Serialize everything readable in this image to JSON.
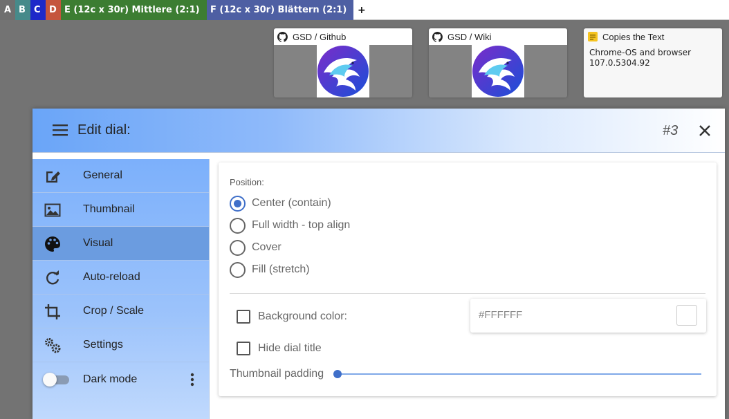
{
  "tabs": [
    {
      "label": "A",
      "color": "#6f6f6f"
    },
    {
      "label": "B",
      "color": "#468a8a"
    },
    {
      "label": "C",
      "color": "#1d29c9"
    },
    {
      "label": "D",
      "color": "#c5553d"
    },
    {
      "label": "E (12c x 30r) Mittlere (2:1)",
      "color": "#3c7d32"
    },
    {
      "label": "F (12c x 30r) Blättern (2:1)",
      "color": "#4e5fa3"
    }
  ],
  "add_tab_label": "+",
  "dials": [
    {
      "title": "GSD / Github",
      "icon": "github-icon"
    },
    {
      "title": "GSD / Wiki",
      "icon": "github-icon"
    },
    {
      "title": "Copies the Text",
      "icon": "note-icon",
      "text_line1": "Chrome-OS and browser",
      "text_line2": "107.0.5304.92"
    }
  ],
  "dialog": {
    "title": "Edit dial:",
    "dial_number": "#3",
    "sidebar": {
      "items": [
        {
          "label": "General",
          "icon": "edit-icon"
        },
        {
          "label": "Thumbnail",
          "icon": "image-icon"
        },
        {
          "label": "Visual",
          "icon": "palette-icon",
          "active": true
        },
        {
          "label": "Auto-reload",
          "icon": "reload-icon"
        },
        {
          "label": "Crop / Scale",
          "icon": "crop-icon"
        },
        {
          "label": "Settings",
          "icon": "gears-icon"
        },
        {
          "label": "Dark mode",
          "icon": "toggle-off"
        }
      ]
    },
    "visual": {
      "position_label": "Position:",
      "position_options": [
        "Center (contain)",
        "Full width - top align",
        "Cover",
        "Fill (stretch)"
      ],
      "selected_position": "Center (contain)",
      "background_color_label": "Background color:",
      "background_color_checked": false,
      "background_color_value": "#FFFFFF",
      "hide_title_label": "Hide dial title",
      "hide_title_checked": false,
      "thumbnail_padding_label": "Thumbnail padding",
      "thumbnail_padding_value": 0
    }
  },
  "colors": {
    "accent": "#3f6fc9",
    "header_gradient_start": "#6aa5f8",
    "sidebar_active": "#6b9ce0",
    "background": "#737373"
  }
}
